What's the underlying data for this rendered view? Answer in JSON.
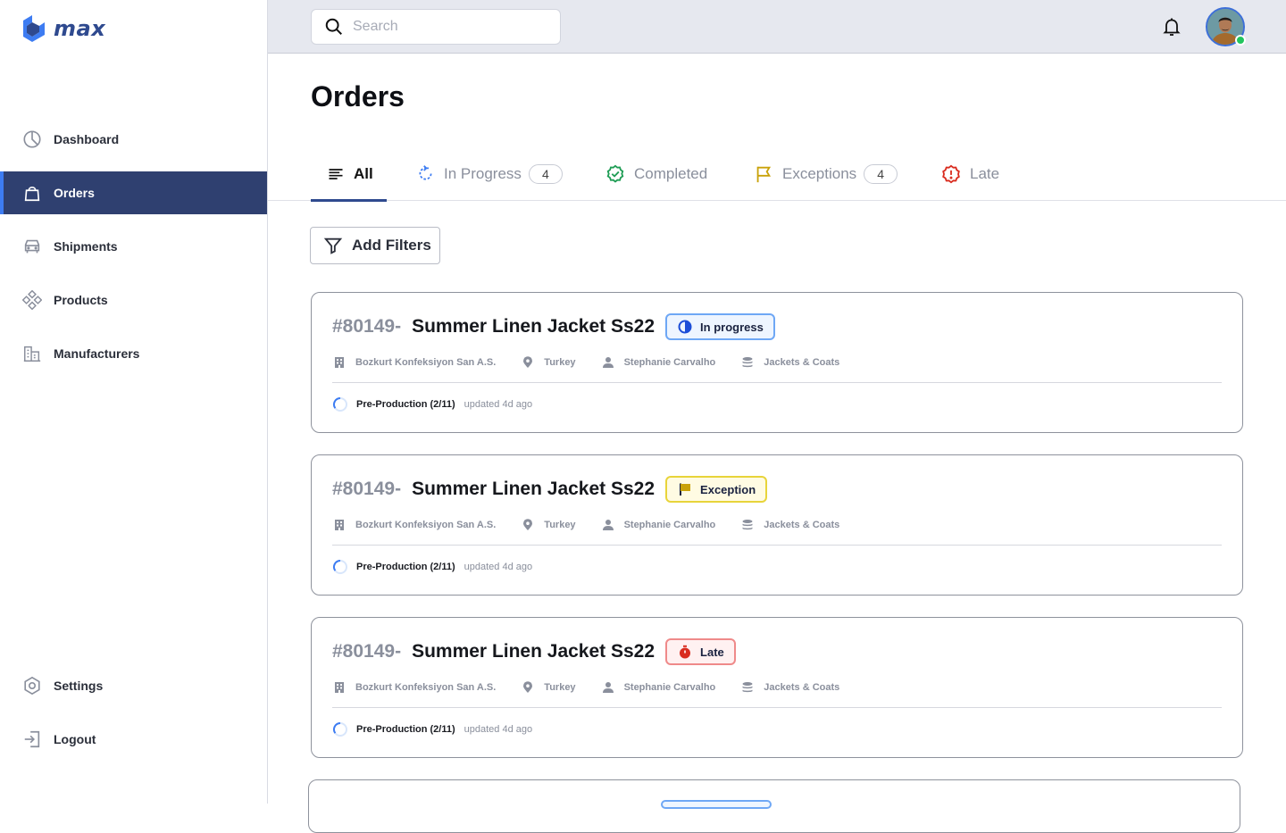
{
  "app": {
    "name": "max"
  },
  "sidebar": {
    "items": [
      {
        "label": "Dashboard",
        "icon": "pie-chart-icon",
        "active": false
      },
      {
        "label": "Orders",
        "icon": "shopping-bag-icon",
        "active": true
      },
      {
        "label": "Shipments",
        "icon": "truck-icon",
        "active": false
      },
      {
        "label": "Products",
        "icon": "products-icon",
        "active": false
      },
      {
        "label": "Manufacturers",
        "icon": "factory-icon",
        "active": false
      }
    ],
    "bottom": [
      {
        "label": "Settings",
        "icon": "gear-icon"
      },
      {
        "label": "Logout",
        "icon": "logout-icon"
      }
    ]
  },
  "topbar": {
    "search": {
      "placeholder": "Search",
      "value": ""
    },
    "notifications_icon": "bell-icon",
    "avatar_status": "online"
  },
  "page": {
    "title": "Orders"
  },
  "tabs": [
    {
      "label": "All",
      "icon": "list-icon",
      "active": true
    },
    {
      "label": "In Progress",
      "icon": "refresh-icon",
      "count": "4"
    },
    {
      "label": "Completed",
      "icon": "check-badge-icon"
    },
    {
      "label": "Exceptions",
      "icon": "flag-icon",
      "count": "4"
    },
    {
      "label": "Late",
      "icon": "alert-octagon-icon"
    }
  ],
  "filters": {
    "button_label": "Add Filters"
  },
  "orders": [
    {
      "id": "#80149-",
      "name": "Summer Linen Jacket Ss22",
      "badge": "In progress",
      "manufacturer": "Bozkurt Konfeksiyon San  A.S.",
      "country": "Turkey",
      "assignee": "Stephanie Carvalho",
      "category": "Jackets & Coats",
      "stage": "Pre-Production (2/11)",
      "updated": "updated 4d ago"
    },
    {
      "id": "#80149-",
      "name": "Summer Linen Jacket Ss22",
      "badge": "Exception",
      "manufacturer": "Bozkurt Konfeksiyon San  A.S.",
      "country": "Turkey",
      "assignee": "Stephanie Carvalho",
      "category": "Jackets & Coats",
      "stage": "Pre-Production (2/11)",
      "updated": "updated 4d ago"
    },
    {
      "id": "#80149-",
      "name": "Summer Linen Jacket Ss22",
      "badge": "Late",
      "manufacturer": "Bozkurt Konfeksiyon San  A.S.",
      "country": "Turkey",
      "assignee": "Stephanie Carvalho",
      "category": "Jackets & Coats",
      "stage": "Pre-Production (2/11)",
      "updated": "updated 4d ago"
    }
  ],
  "colors": {
    "brand": "#2f4a8f",
    "active_nav": "#2f4070",
    "progress": "#3d7cf2",
    "exception": "#c9a20a",
    "late": "#d92d20",
    "completed": "#1f9d55"
  }
}
